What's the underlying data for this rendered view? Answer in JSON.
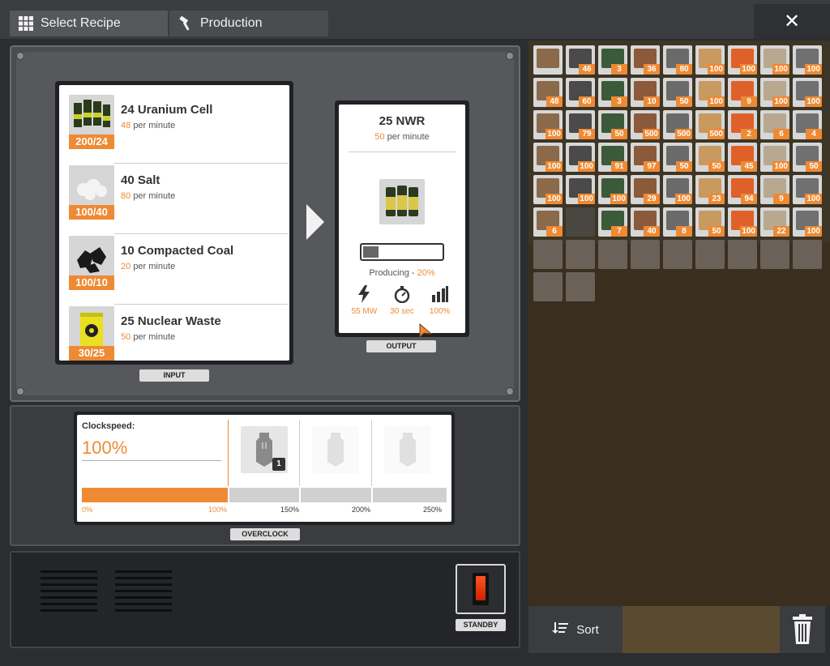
{
  "tabs": {
    "select_recipe": "Select Recipe",
    "production": "Production"
  },
  "close_label": "✕",
  "inputs": {
    "tag": "INPUT",
    "items": [
      {
        "name": "24 Uranium Cell",
        "rate_num": "48",
        "rate_unit": "per minute",
        "count": "200/24",
        "icon": "uranium-cell-icon"
      },
      {
        "name": "40 Salt",
        "rate_num": "80",
        "rate_unit": "per minute",
        "count": "100/40",
        "icon": "salt-icon"
      },
      {
        "name": "10 Compacted Coal",
        "rate_num": "20",
        "rate_unit": "per minute",
        "count": "100/10",
        "icon": "compacted-coal-icon"
      },
      {
        "name": "25 Nuclear Waste",
        "rate_num": "50",
        "rate_unit": "per minute",
        "count": "30/25",
        "icon": "nuclear-waste-icon"
      }
    ]
  },
  "output": {
    "tag": "OUTPUT",
    "name": "25 NWR",
    "rate_num": "50",
    "rate_unit": "per minute",
    "producing_label": "Producing",
    "producing_sep": " - ",
    "producing_pct": "20%",
    "progress": 0.2,
    "power": "55 MW",
    "cycle_time": "30 sec",
    "efficiency": "100%"
  },
  "overclock": {
    "tag": "OVERCLOCK",
    "clock_label": "Clockspeed:",
    "clock_value": "100%",
    "shard_count": "1",
    "ticks": [
      "0%",
      "100%",
      "150%",
      "200%",
      "250%"
    ],
    "fill_fraction": 0.4
  },
  "standby": {
    "tag": "STANDBY"
  },
  "inventory": {
    "sort_label": "Sort",
    "rows": [
      [
        "",
        "46",
        "3",
        "36",
        "80",
        "100",
        "100",
        "100",
        "100"
      ],
      [
        "48",
        "60",
        "3",
        "10",
        "50",
        "100",
        "9",
        "100",
        "100"
      ],
      [
        "100",
        "79",
        "50",
        "500",
        "500",
        "500",
        "2",
        "6",
        "4"
      ],
      [
        "100",
        "100",
        "91",
        "97",
        "50",
        "50",
        "45",
        "100",
        "50"
      ],
      [
        "100",
        "100",
        "100",
        "29",
        "100",
        "23",
        "94",
        "9",
        "100"
      ],
      [
        "6",
        "",
        "7",
        "40",
        "8",
        "50",
        "100",
        "22",
        "100"
      ]
    ]
  },
  "colors": {
    "accent": "#ee8a34",
    "panel": "#4a4c50",
    "card": "#ffffff"
  }
}
